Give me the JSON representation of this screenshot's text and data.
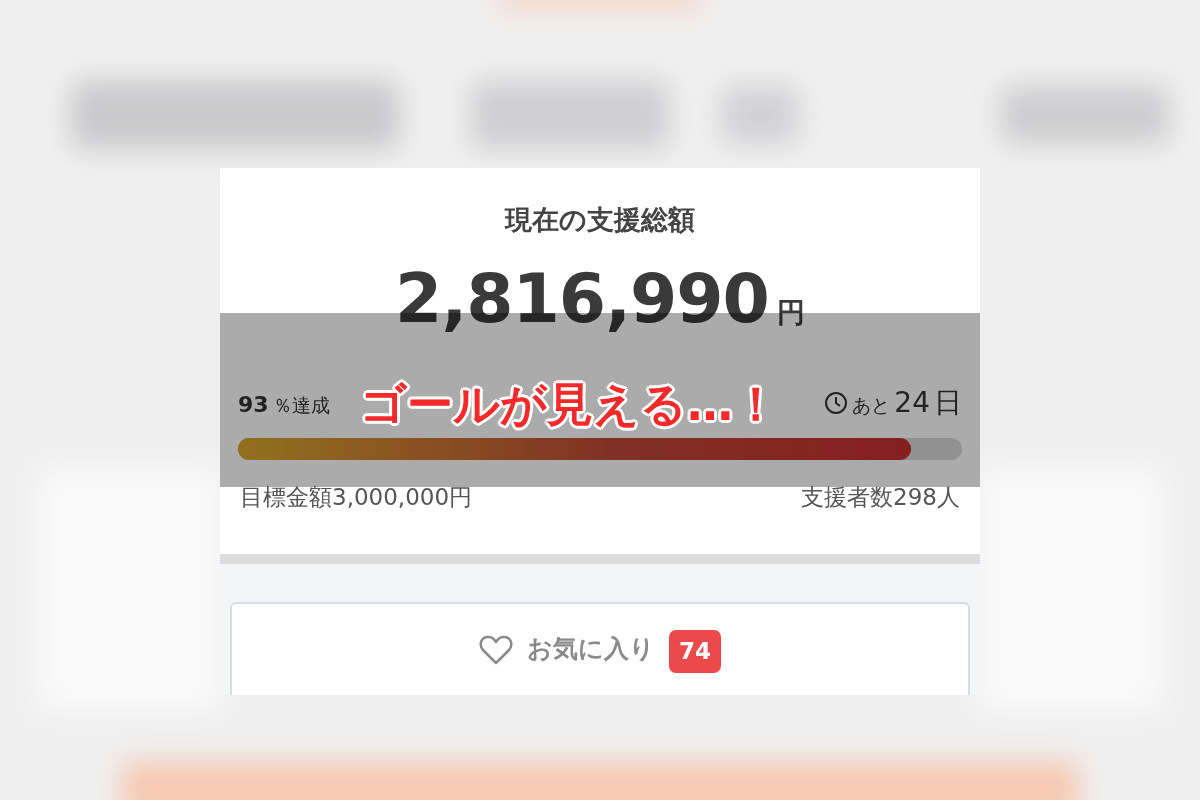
{
  "card": {
    "title": "現在の支援総額",
    "amount": "2,816,990",
    "currency": "円",
    "percent": "93",
    "percent_label": "％達成",
    "remaining_prefix": "あと",
    "remaining_days": "24",
    "remaining_unit": "日",
    "progress": {
      "level": 0.93
    },
    "goal": "目標金額3,000,000円",
    "backers": "支援者数298人"
  },
  "favorite_button": {
    "label": "お気に入り",
    "count": "74"
  },
  "caption": "ゴールが見える…！"
}
